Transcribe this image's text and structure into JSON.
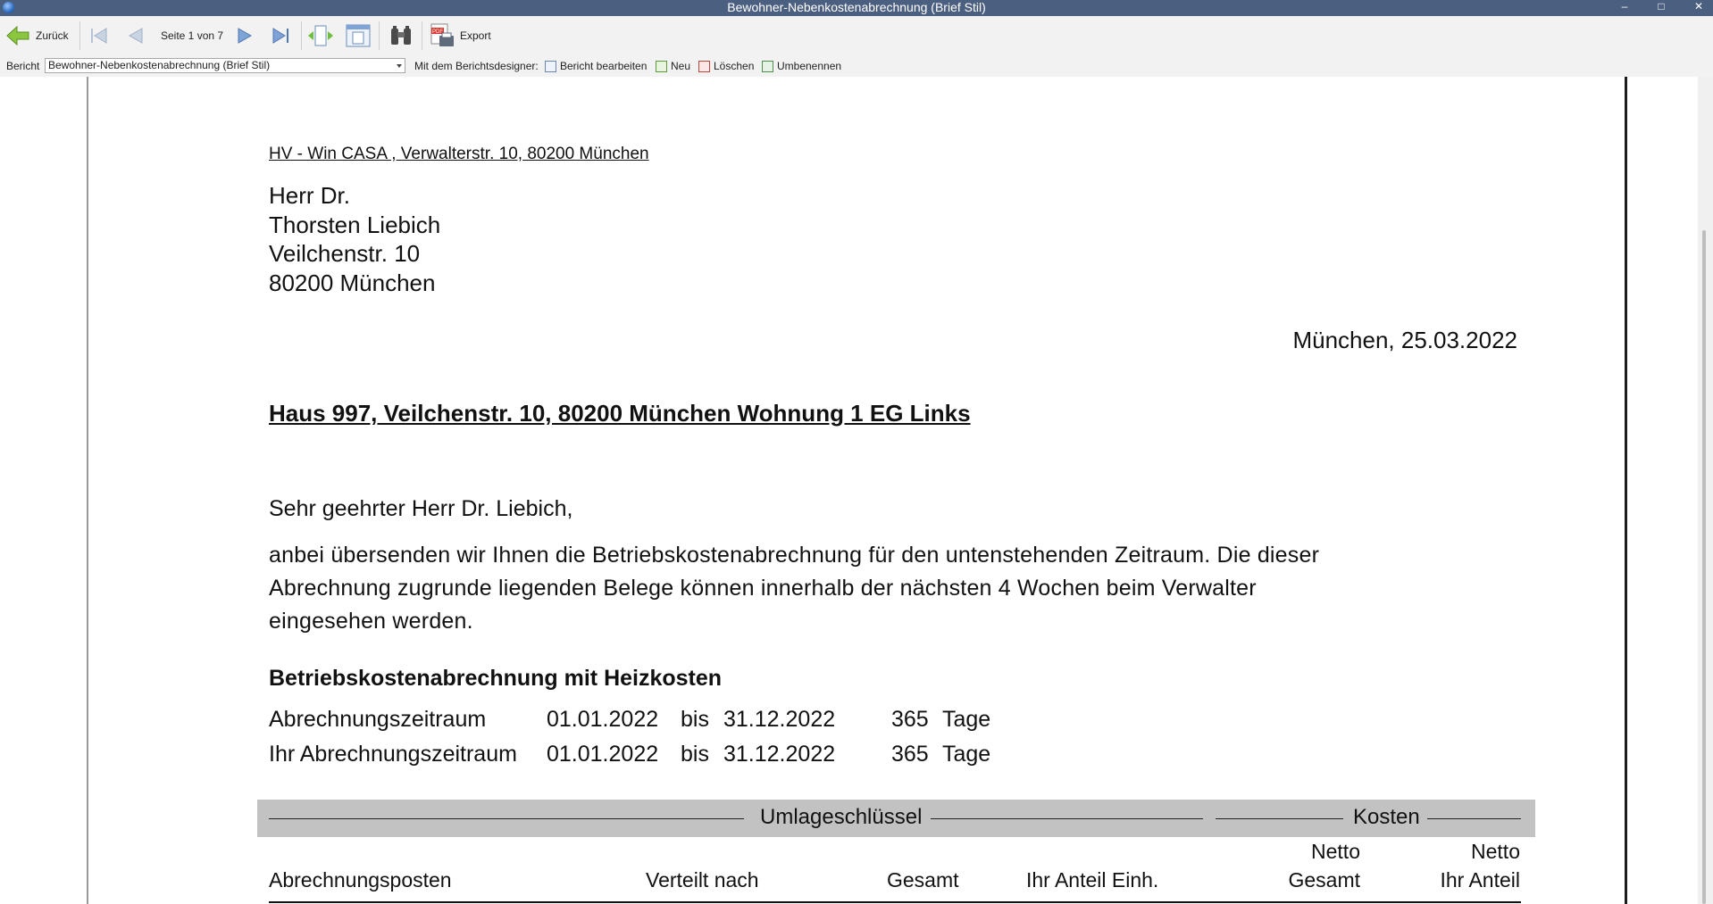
{
  "window": {
    "title": "Bewohner-Nebenkostenabrechnung (Brief Stil)",
    "controls": {
      "minimize": "–",
      "maximize": "□",
      "close": "✕"
    }
  },
  "toolbar": {
    "back_label": "Zurück",
    "page_indicator": "Seite 1 von 7",
    "export_label": "Export",
    "icons": [
      "back-arrow-icon",
      "first-page-icon",
      "previous-page-icon",
      "next-page-icon",
      "last-page-icon",
      "fit-width-icon",
      "single-page-icon",
      "binoculars-search-icon",
      "pdf-export-icon"
    ]
  },
  "reportbar": {
    "report_label": "Bericht",
    "report_selected": "Bewohner-Nebenkostenabrechnung (Brief Stil)",
    "designer_label": "Mit dem Berichtsdesigner:",
    "edit_label": "Bericht bearbeiten",
    "new_label": "Neu",
    "delete_label": "Löschen",
    "rename_label": "Umbenennen"
  },
  "document": {
    "sender_line": "HV - Win CASA , Verwalterstr. 10, 80200 München",
    "recipient": [
      "Herr Dr.",
      "Thorsten Liebich",
      "Veilchenstr. 10",
      "80200 München"
    ],
    "date_line": "München, 25.03.2022",
    "subject": "Haus 997, Veilchenstr. 10, 80200 München  Wohnung 1 EG Links",
    "greeting": "Sehr geehrter Herr Dr. Liebich,",
    "body_lines": [
      "anbei übersenden wir Ihnen die Betriebskostenabrechnung für den untenstehenden Zeitraum. Die dieser",
      "Abrechnung zugrunde liegenden Belege können innerhalb der nächsten 4 Wochen beim Verwalter",
      "eingesehen werden."
    ],
    "section_title": "Betriebskostenabrechnung mit Heizkosten",
    "periods": [
      {
        "label": "Abrechnungszeitraum",
        "from": "01.01.2022",
        "bis": "bis",
        "to": "31.12.2022",
        "days": "365",
        "unit": "Tage"
      },
      {
        "label": "Ihr Abrechnungszeitraum",
        "from": "01.01.2022",
        "bis": "bis",
        "to": "31.12.2022",
        "days": "365",
        "unit": "Tage"
      }
    ],
    "table": {
      "group_umlage": "Umlageschlüssel",
      "group_kosten": "Kosten",
      "col_posten": "Abrechnungsposten",
      "col_verteilt": "Verteilt nach",
      "col_gesamt": "Gesamt",
      "col_anteil": "Ihr Anteil Einh.",
      "col_netto1_top": "Netto",
      "col_netto1_bottom": "Gesamt",
      "col_netto2_top": "Netto",
      "col_netto2_bottom": "Ihr Anteil"
    }
  }
}
